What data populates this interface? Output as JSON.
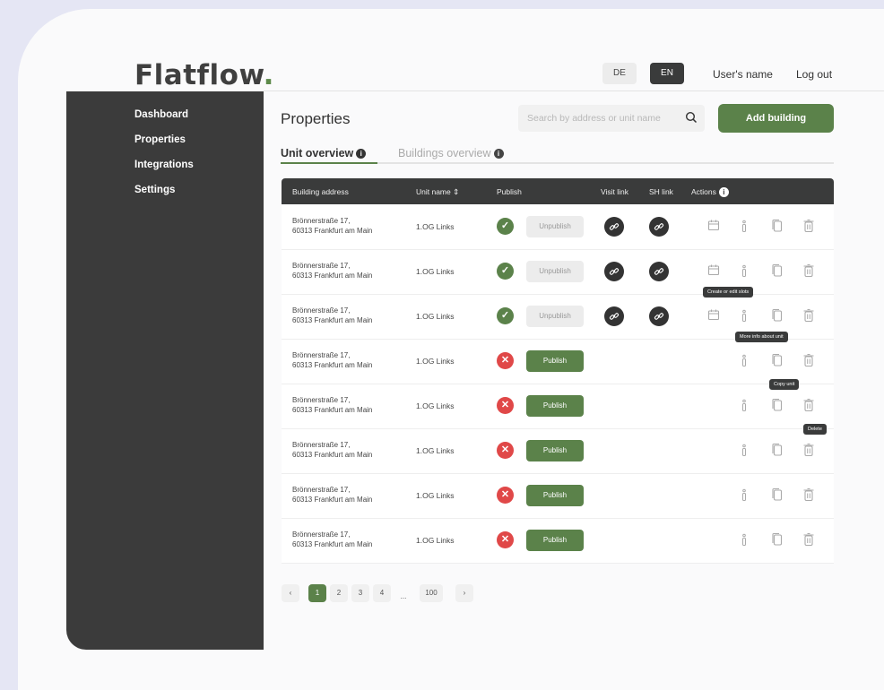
{
  "app": {
    "logo": "Flatflow",
    "logo_dot": "."
  },
  "header": {
    "lang_de": "DE",
    "lang_en": "EN",
    "user_name": "User's name",
    "logout": "Log out"
  },
  "sidebar": {
    "items": [
      {
        "label": "Dashboard"
      },
      {
        "label": "Properties"
      },
      {
        "label": "Integrations"
      },
      {
        "label": "Settings"
      }
    ]
  },
  "main": {
    "title": "Properties",
    "search_placeholder": "Search by address or unit name",
    "add_button": "Add building",
    "tabs": [
      {
        "label": "Unit overview"
      },
      {
        "label": "Buildings overview"
      }
    ]
  },
  "table": {
    "headers": {
      "address": "Building address",
      "unit": "Unit name ⇕",
      "publish": "Publish",
      "visit": "Visit link",
      "sh": "SH link",
      "actions": "Actions"
    },
    "rows": [
      {
        "addr1": "Brönnerstraße 17,",
        "addr2": "60313 Frankfurt am Main",
        "unit": "1.OG Links",
        "status": "published",
        "button": "Unpublish"
      },
      {
        "addr1": "Brönnerstraße 17,",
        "addr2": "60313 Frankfurt am Main",
        "unit": "1.OG Links",
        "status": "published",
        "button": "Unpublish"
      },
      {
        "addr1": "Brönnerstraße 17,",
        "addr2": "60313 Frankfurt am Main",
        "unit": "1.OG Links",
        "status": "published",
        "button": "Unpublish"
      },
      {
        "addr1": "Brönnerstraße 17,",
        "addr2": "60313 Frankfurt am Main",
        "unit": "1.OG Links",
        "status": "unpublished",
        "button": "Publish"
      },
      {
        "addr1": "Brönnerstraße 17,",
        "addr2": "60313 Frankfurt am Main",
        "unit": "1.OG Links",
        "status": "unpublished",
        "button": "Publish"
      },
      {
        "addr1": "Brönnerstraße 17,",
        "addr2": "60313 Frankfurt am Main",
        "unit": "1.OG Links",
        "status": "unpublished",
        "button": "Publish"
      },
      {
        "addr1": "Brönnerstraße 17,",
        "addr2": "60313 Frankfurt am Main",
        "unit": "1.OG Links",
        "status": "unpublished",
        "button": "Publish"
      },
      {
        "addr1": "Brönnerstraße 17,",
        "addr2": "60313 Frankfurt am Main",
        "unit": "1.OG Links",
        "status": "unpublished",
        "button": "Publish"
      }
    ]
  },
  "tooltips": {
    "calendar": "Create or edit slots",
    "info": "More info about unit",
    "copy": "Copy unit",
    "delete": "Delete"
  },
  "pagination": {
    "pages": [
      "1",
      "2",
      "3",
      "4",
      "100"
    ],
    "ellipsis": "...",
    "current": "1"
  },
  "colors": {
    "accent": "#5b824a",
    "dark": "#3a3b3b",
    "error": "#e04848"
  }
}
